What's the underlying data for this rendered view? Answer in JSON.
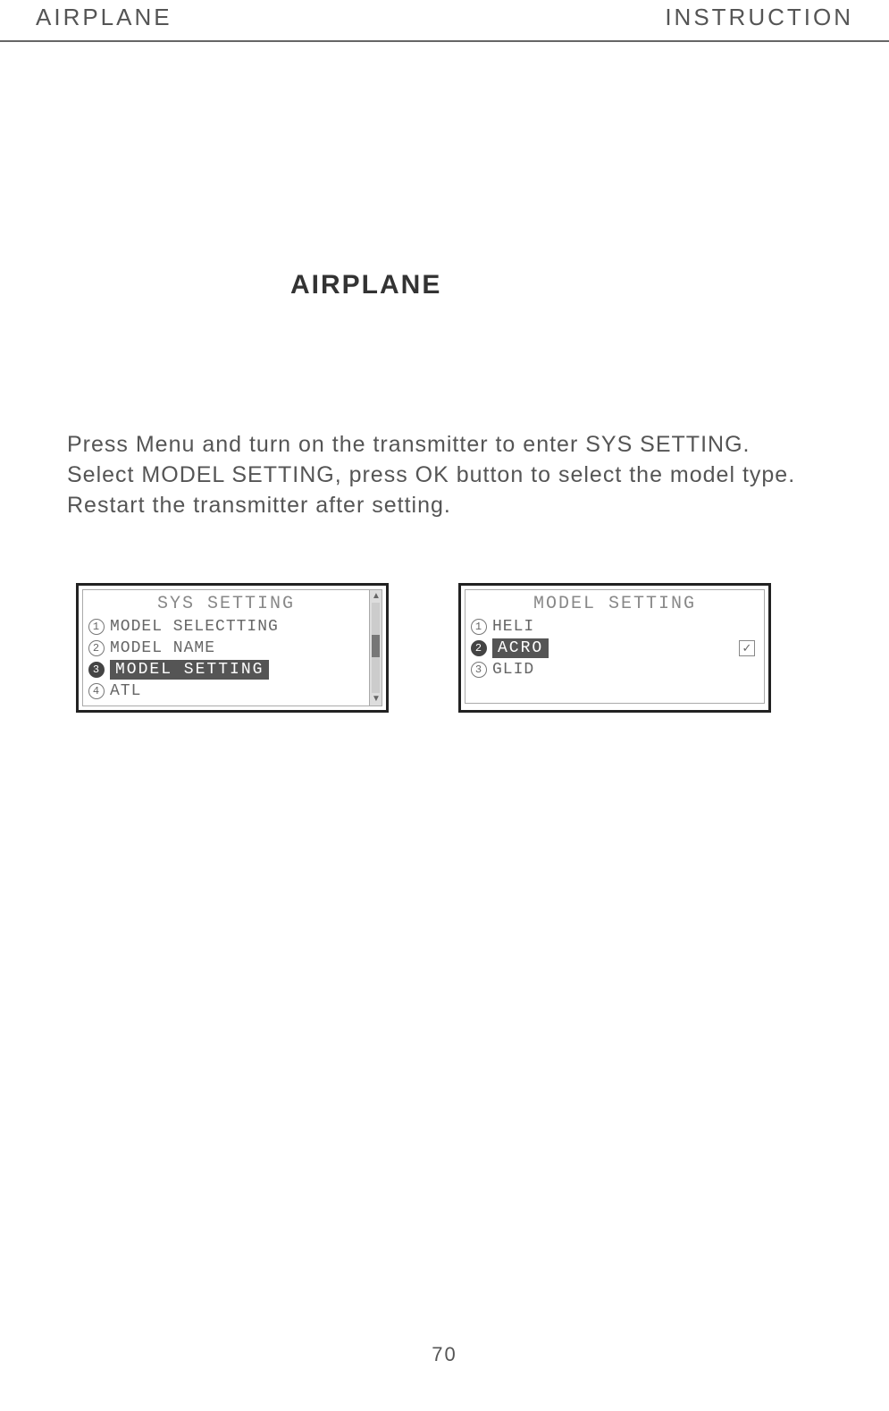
{
  "header": {
    "left": "AIRPLANE",
    "right": "INSTRUCTION"
  },
  "section_title": "AIRPLANE",
  "body": {
    "line1": "Press Menu and turn on the transmitter to enter SYS SETTING.",
    "line2": "Select MODEL SETTING, press OK button to select the model type.",
    "line3": "Restart the transmitter after setting."
  },
  "screens": {
    "left": {
      "title": "SYS SETTING",
      "items": [
        {
          "num": "1",
          "label": "MODEL SELECTTING",
          "selected": false
        },
        {
          "num": "2",
          "label": "MODEL NAME",
          "selected": false
        },
        {
          "num": "3",
          "label": "MODEL SETTING",
          "selected": true
        },
        {
          "num": "4",
          "label": "ATL",
          "selected": false
        }
      ]
    },
    "right": {
      "title": "MODEL SETTING",
      "items": [
        {
          "num": "1",
          "label": "HELI",
          "selected": false
        },
        {
          "num": "2",
          "label": "ACRO",
          "selected": true
        },
        {
          "num": "3",
          "label": "GLID",
          "selected": false
        }
      ],
      "check": "✓"
    }
  },
  "page_number": "70"
}
